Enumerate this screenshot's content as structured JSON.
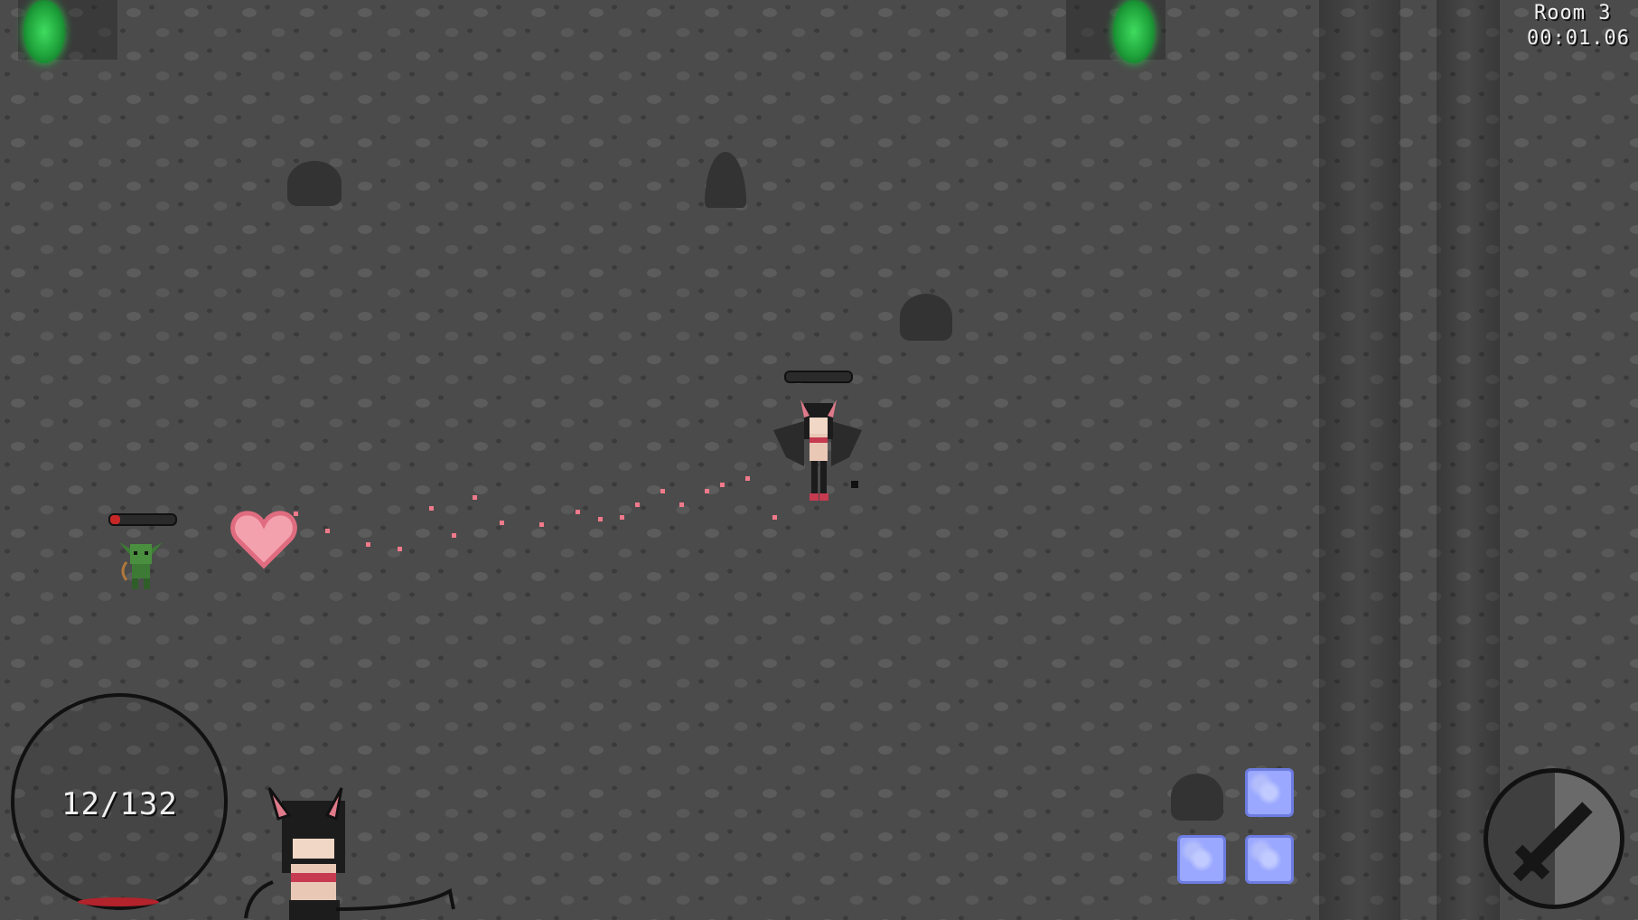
{
  "hud": {
    "room_label": "Room 3",
    "timer": "00:01.06",
    "hp_text": "12/132"
  },
  "player": {
    "name": "demon-girl-player"
  },
  "enemy": {
    "name": "goblin-archer",
    "health_fraction": 0.15
  },
  "projectile": {
    "name": "heart-projectile"
  },
  "abilities": {
    "slots": [
      "empty",
      "frost-rune",
      "frost-rune",
      "frost-rune"
    ]
  },
  "icons": {
    "attack": "sword-icon",
    "portal": "green-portal-icon"
  },
  "colors": {
    "floor": "#4b4b4b",
    "portal": "#2cc44b",
    "hp": "#c62828",
    "heart": "#f08a9a",
    "ability": "#9aa8ff"
  }
}
